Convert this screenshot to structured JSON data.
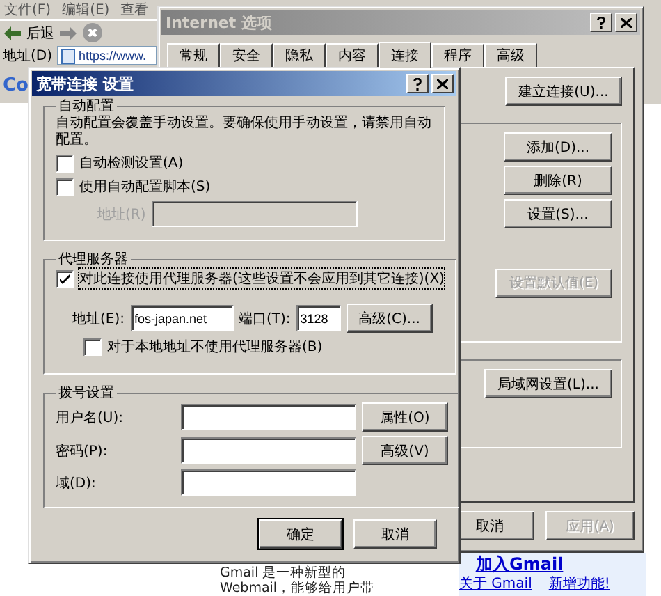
{
  "browser": {
    "menu": [
      "文件(F)",
      "编辑(E)",
      "查看"
    ],
    "back_label": "后退",
    "address_label": "地址(D)",
    "address_value": "https://www.",
    "toolbar_text": "Co",
    "page": {
      "intro_lines": [
        "Gmail 是一种新型的",
        "Webmail，能够给用户带"
      ],
      "join_link": "加入Gmail",
      "links": [
        "关于 Gmail",
        "新增功能!"
      ]
    }
  },
  "options_window": {
    "title": "Internet 选项",
    "active": false,
    "tabs": [
      {
        "label": "常规",
        "selected": false
      },
      {
        "label": "安全",
        "selected": false
      },
      {
        "label": "隐私",
        "selected": false
      },
      {
        "label": "内容",
        "selected": false
      },
      {
        "label": "连接",
        "selected": true
      },
      {
        "label": "程序",
        "selected": false
      },
      {
        "label": "高级",
        "selected": false
      }
    ],
    "setup_button": {
      "label": "建立连接(U)...",
      "disabled": false
    },
    "dialup_buttons": [
      {
        "label": "添加(D)...",
        "disabled": false
      },
      {
        "label": "删除(R)",
        "disabled": false
      },
      {
        "label": "设置(S)...",
        "disabled": false
      }
    ],
    "default_button": {
      "label": "设置默认值(E)",
      "disabled": true
    },
    "lan_button": {
      "label": "局域网设置(L)...",
      "disabled": false
    },
    "footer_buttons": [
      {
        "label": "取消",
        "disabled": false
      },
      {
        "label": "应用(A)",
        "disabled": true
      }
    ]
  },
  "dialog": {
    "title": "宽带连接 设置",
    "active": true,
    "auto_config": {
      "legend": "自动配置",
      "description": "自动配置会覆盖手动设置。要确保使用手动设置，请禁用自动配置。",
      "options": [
        {
          "label": "自动检测设置(A)",
          "checked": false
        },
        {
          "label": "使用自动配置脚本(S)",
          "checked": false
        }
      ],
      "address": {
        "label": "地址(R)",
        "disabled": true
      }
    },
    "proxy": {
      "legend": "代理服务器",
      "use_proxy": {
        "label": "对此连接使用代理服务器(这些设置不会应用到其它连接)(X)",
        "checked": true,
        "focused": true
      },
      "address_label": "地址(E):",
      "address_value": "fos-japan.net",
      "port_label": "端口(T):",
      "port_value": "3128",
      "advanced_button": "高级(C)...",
      "bypass_local": {
        "label": "对于本地地址不使用代理服务器(B)",
        "checked": false
      }
    },
    "dialing": {
      "legend": "拨号设置",
      "fields": [
        {
          "label": "用户名(U):",
          "button": "属性(O)"
        },
        {
          "label": "密码(P):",
          "button": "高级(V)"
        },
        {
          "label": "域(D):"
        }
      ]
    },
    "buttons": [
      {
        "label": "确定",
        "default": true
      },
      {
        "label": "取消",
        "default": false
      }
    ]
  }
}
